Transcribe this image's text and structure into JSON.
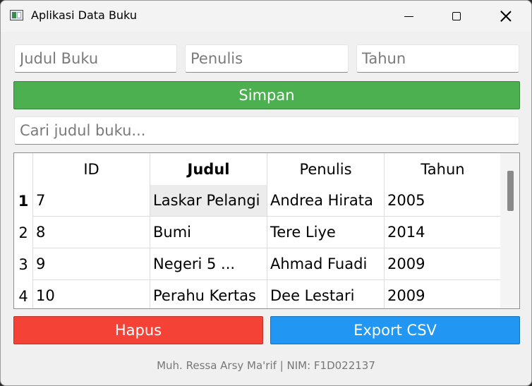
{
  "window": {
    "title": "Aplikasi Data Buku",
    "icon": "app-window-icon"
  },
  "form": {
    "judul_placeholder": "Judul Buku",
    "penulis_placeholder": "Penulis",
    "tahun_placeholder": "Tahun",
    "simpan_label": "Simpan",
    "simpan_color": "#4caf50"
  },
  "search": {
    "placeholder": "Cari judul buku..."
  },
  "table": {
    "headers": [
      "ID",
      "Judul",
      "Penulis",
      "Tahun"
    ],
    "rows": [
      {
        "num": "1",
        "id": "7",
        "judul": "Laskar Pelangi",
        "penulis": "Andrea Hirata",
        "tahun": "2005"
      },
      {
        "num": "2",
        "id": "8",
        "judul": "Bumi",
        "penulis": "Tere Liye",
        "tahun": "2014"
      },
      {
        "num": "3",
        "id": "9",
        "judul": "Negeri 5 ...",
        "penulis": "Ahmad Fuadi",
        "tahun": "2009"
      },
      {
        "num": "4",
        "id": "10",
        "judul": "Perahu Kertas",
        "penulis": "Dee Lestari",
        "tahun": "2009"
      }
    ]
  },
  "actions": {
    "hapus_label": "Hapus",
    "hapus_color": "#f44336",
    "export_label": "Export CSV",
    "export_color": "#2196f3"
  },
  "footer": {
    "text": "Muh. Ressa Arsy Ma'rif | NIM: F1D022137"
  }
}
